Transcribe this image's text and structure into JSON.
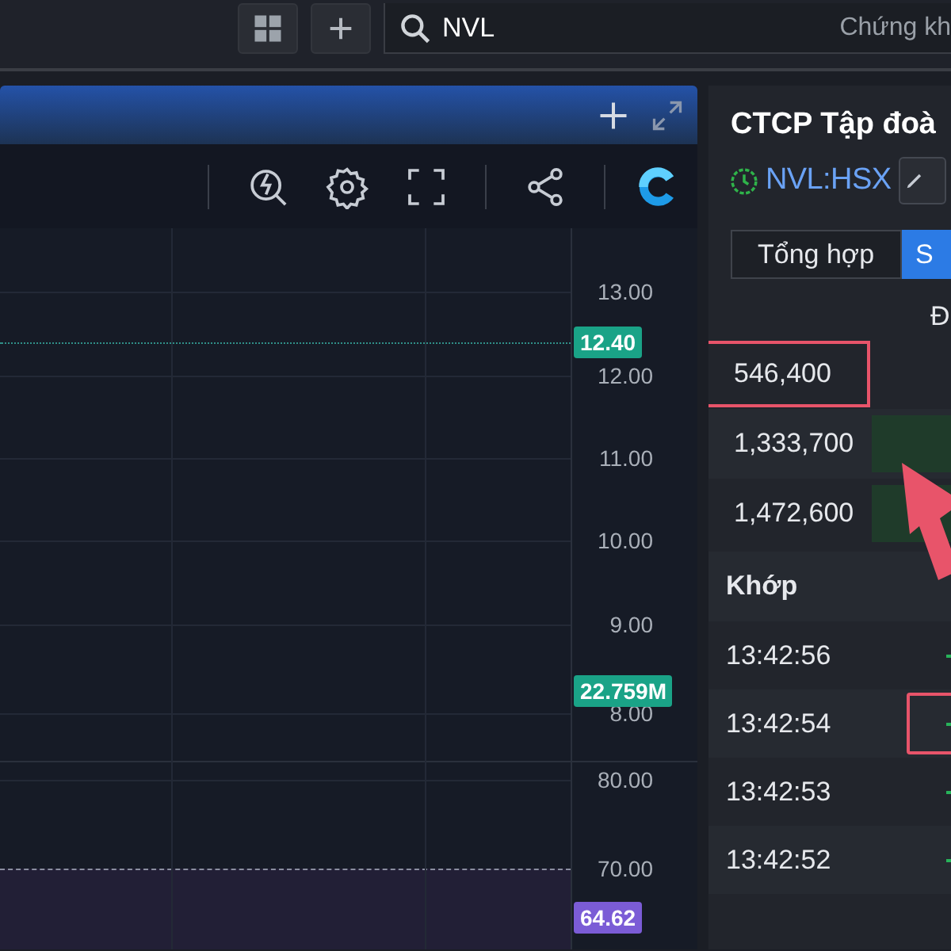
{
  "top_bar": {
    "search": {
      "value": "NVL",
      "hint": "Chứng kh"
    }
  },
  "chart_panel": {
    "price_axis": [
      "13.00",
      "12.00",
      "11.00",
      "10.00",
      "9.00",
      "8.00"
    ],
    "volume_axis": [
      "80.00",
      "70.00"
    ],
    "tags": [
      {
        "text": "12.40",
        "color": "#1aa387"
      },
      {
        "text": "22.759M",
        "color": "#1aa387"
      },
      {
        "text": "64.62",
        "color": "#7b5cd6"
      }
    ]
  },
  "quote_panel": {
    "title": "CTCP Tập đoà",
    "symbol": "NVL:HSX",
    "tabs": [
      {
        "label": "Tổng hợp",
        "selected": false
      },
      {
        "label": "S",
        "selected": true
      }
    ],
    "column_header": "Đ",
    "volume_rows": [
      {
        "volume": "546,400",
        "bar": false,
        "highlighted": true
      },
      {
        "volume": "1,333,700",
        "bar": true,
        "highlighted": false
      },
      {
        "volume": "1,472,600",
        "bar": true,
        "highlighted": false
      }
    ],
    "trades_header": "Khớp",
    "trades": [
      {
        "time": "13:42:56",
        "highlighted": false
      },
      {
        "time": "13:42:54",
        "highlighted": true
      },
      {
        "time": "13:42:53",
        "highlighted": false
      },
      {
        "time": "13:42:52",
        "highlighted": false
      }
    ]
  },
  "annotations": [
    {
      "kind": "arrow",
      "color": "#e8546a"
    }
  ]
}
